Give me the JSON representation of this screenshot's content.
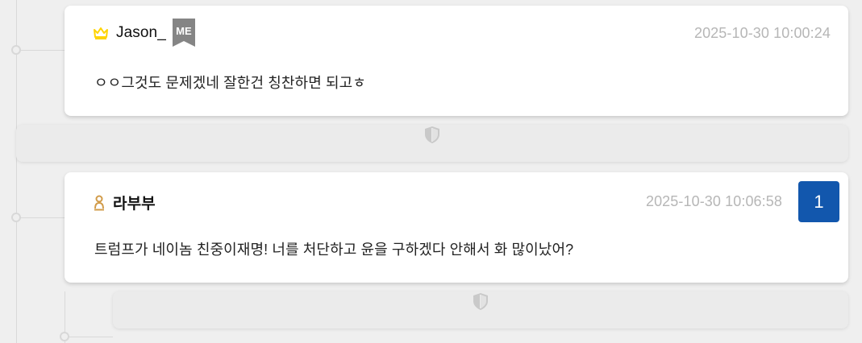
{
  "comments": [
    {
      "author": "Jason_",
      "badge": "ME",
      "timestamp": "2025-10-30 10:00:24",
      "message": "ㅇㅇ그것도 문제겠네 잘한건 칭찬하면 되고ㅎ",
      "role_icon": "crown-icon"
    },
    {
      "author": "라부부",
      "timestamp": "2025-10-30 10:06:58",
      "message": "트럼프가 네이놈 친중이재명! 너를 처단하고 윤을 구하겠다 안해서 화 많이났어?",
      "count": "1",
      "role_icon": "person-icon"
    }
  ],
  "hidden_items": [
    {
      "icon": "shield-icon"
    },
    {
      "icon": "shield-icon"
    }
  ],
  "colors": {
    "accent": "#1257ad",
    "background": "#efefef",
    "timestamp": "#b6b6b6",
    "crown": "#ffd400",
    "person": "#d19b49"
  }
}
